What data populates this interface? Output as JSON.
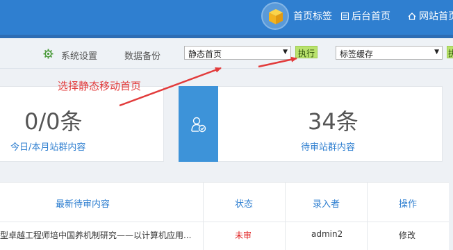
{
  "header": {
    "brand_label": "首页标签",
    "backend_home": "后台首页",
    "site_home": "网站首页"
  },
  "toolbar": {
    "system_settings": "系统设置",
    "data_backup": "数据备份",
    "select1_value": "静态首页",
    "execute1": "执行",
    "select2_value": "标签缓存",
    "execute2": "执"
  },
  "annotation": {
    "text": "选择静态移动首页",
    "color": "#e23b3b"
  },
  "stats": [
    {
      "value": "0/0条",
      "label": "今日/本月站群内容"
    },
    {
      "value": "34条",
      "label": "待审站群内容",
      "icon": "user-check-icon"
    }
  ],
  "table": {
    "columns": [
      "最新待审内容",
      "状态",
      "录入者",
      "操作"
    ],
    "rows": [
      {
        "title": "型卓越工程师培中国养机制研究——以计算机应用...",
        "status": "未审",
        "author": "admin2",
        "action": "修改"
      }
    ]
  },
  "colors": {
    "header_blue": "#2f7fd0",
    "link_blue": "#2f7fd0",
    "execute_green": "#b9e26d",
    "status_red": "#e02020"
  }
}
